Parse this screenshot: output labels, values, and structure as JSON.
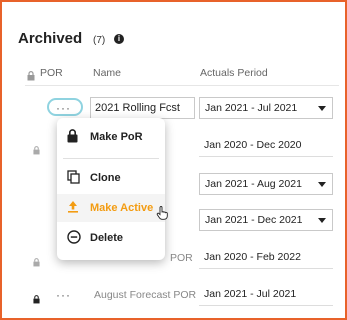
{
  "section": {
    "title": "Archived",
    "count": "(7)"
  },
  "columns": {
    "por": "POR",
    "name": "Name",
    "actuals": "Actuals Period"
  },
  "rows": [
    {
      "name": "2021 Rolling Fcst",
      "period": "Jan 2021 - Jul 2021"
    },
    {
      "name": "",
      "period": "Jan 2020 - Dec 2020"
    },
    {
      "name": "",
      "period": "Jan 2021 - Aug 2021"
    },
    {
      "name": "",
      "period": "Jan 2021 - Dec 2021"
    },
    {
      "name": "POR",
      "period": "Jan 2020 - Feb 2022"
    },
    {
      "name": "August Forecast POR",
      "period": "Jan 2021 - Jul 2021"
    }
  ],
  "menu": {
    "items": [
      {
        "label": "Make PoR",
        "icon": "lock-icon"
      },
      {
        "label": "Clone",
        "icon": "copy-icon"
      },
      {
        "label": "Make Active",
        "icon": "upload-icon"
      },
      {
        "label": "Delete",
        "icon": "minus-circle-icon"
      }
    ],
    "accent": "#f39c12"
  },
  "colors": {
    "frame": "#e8622a",
    "focus_ring": "#8fd3e0"
  }
}
